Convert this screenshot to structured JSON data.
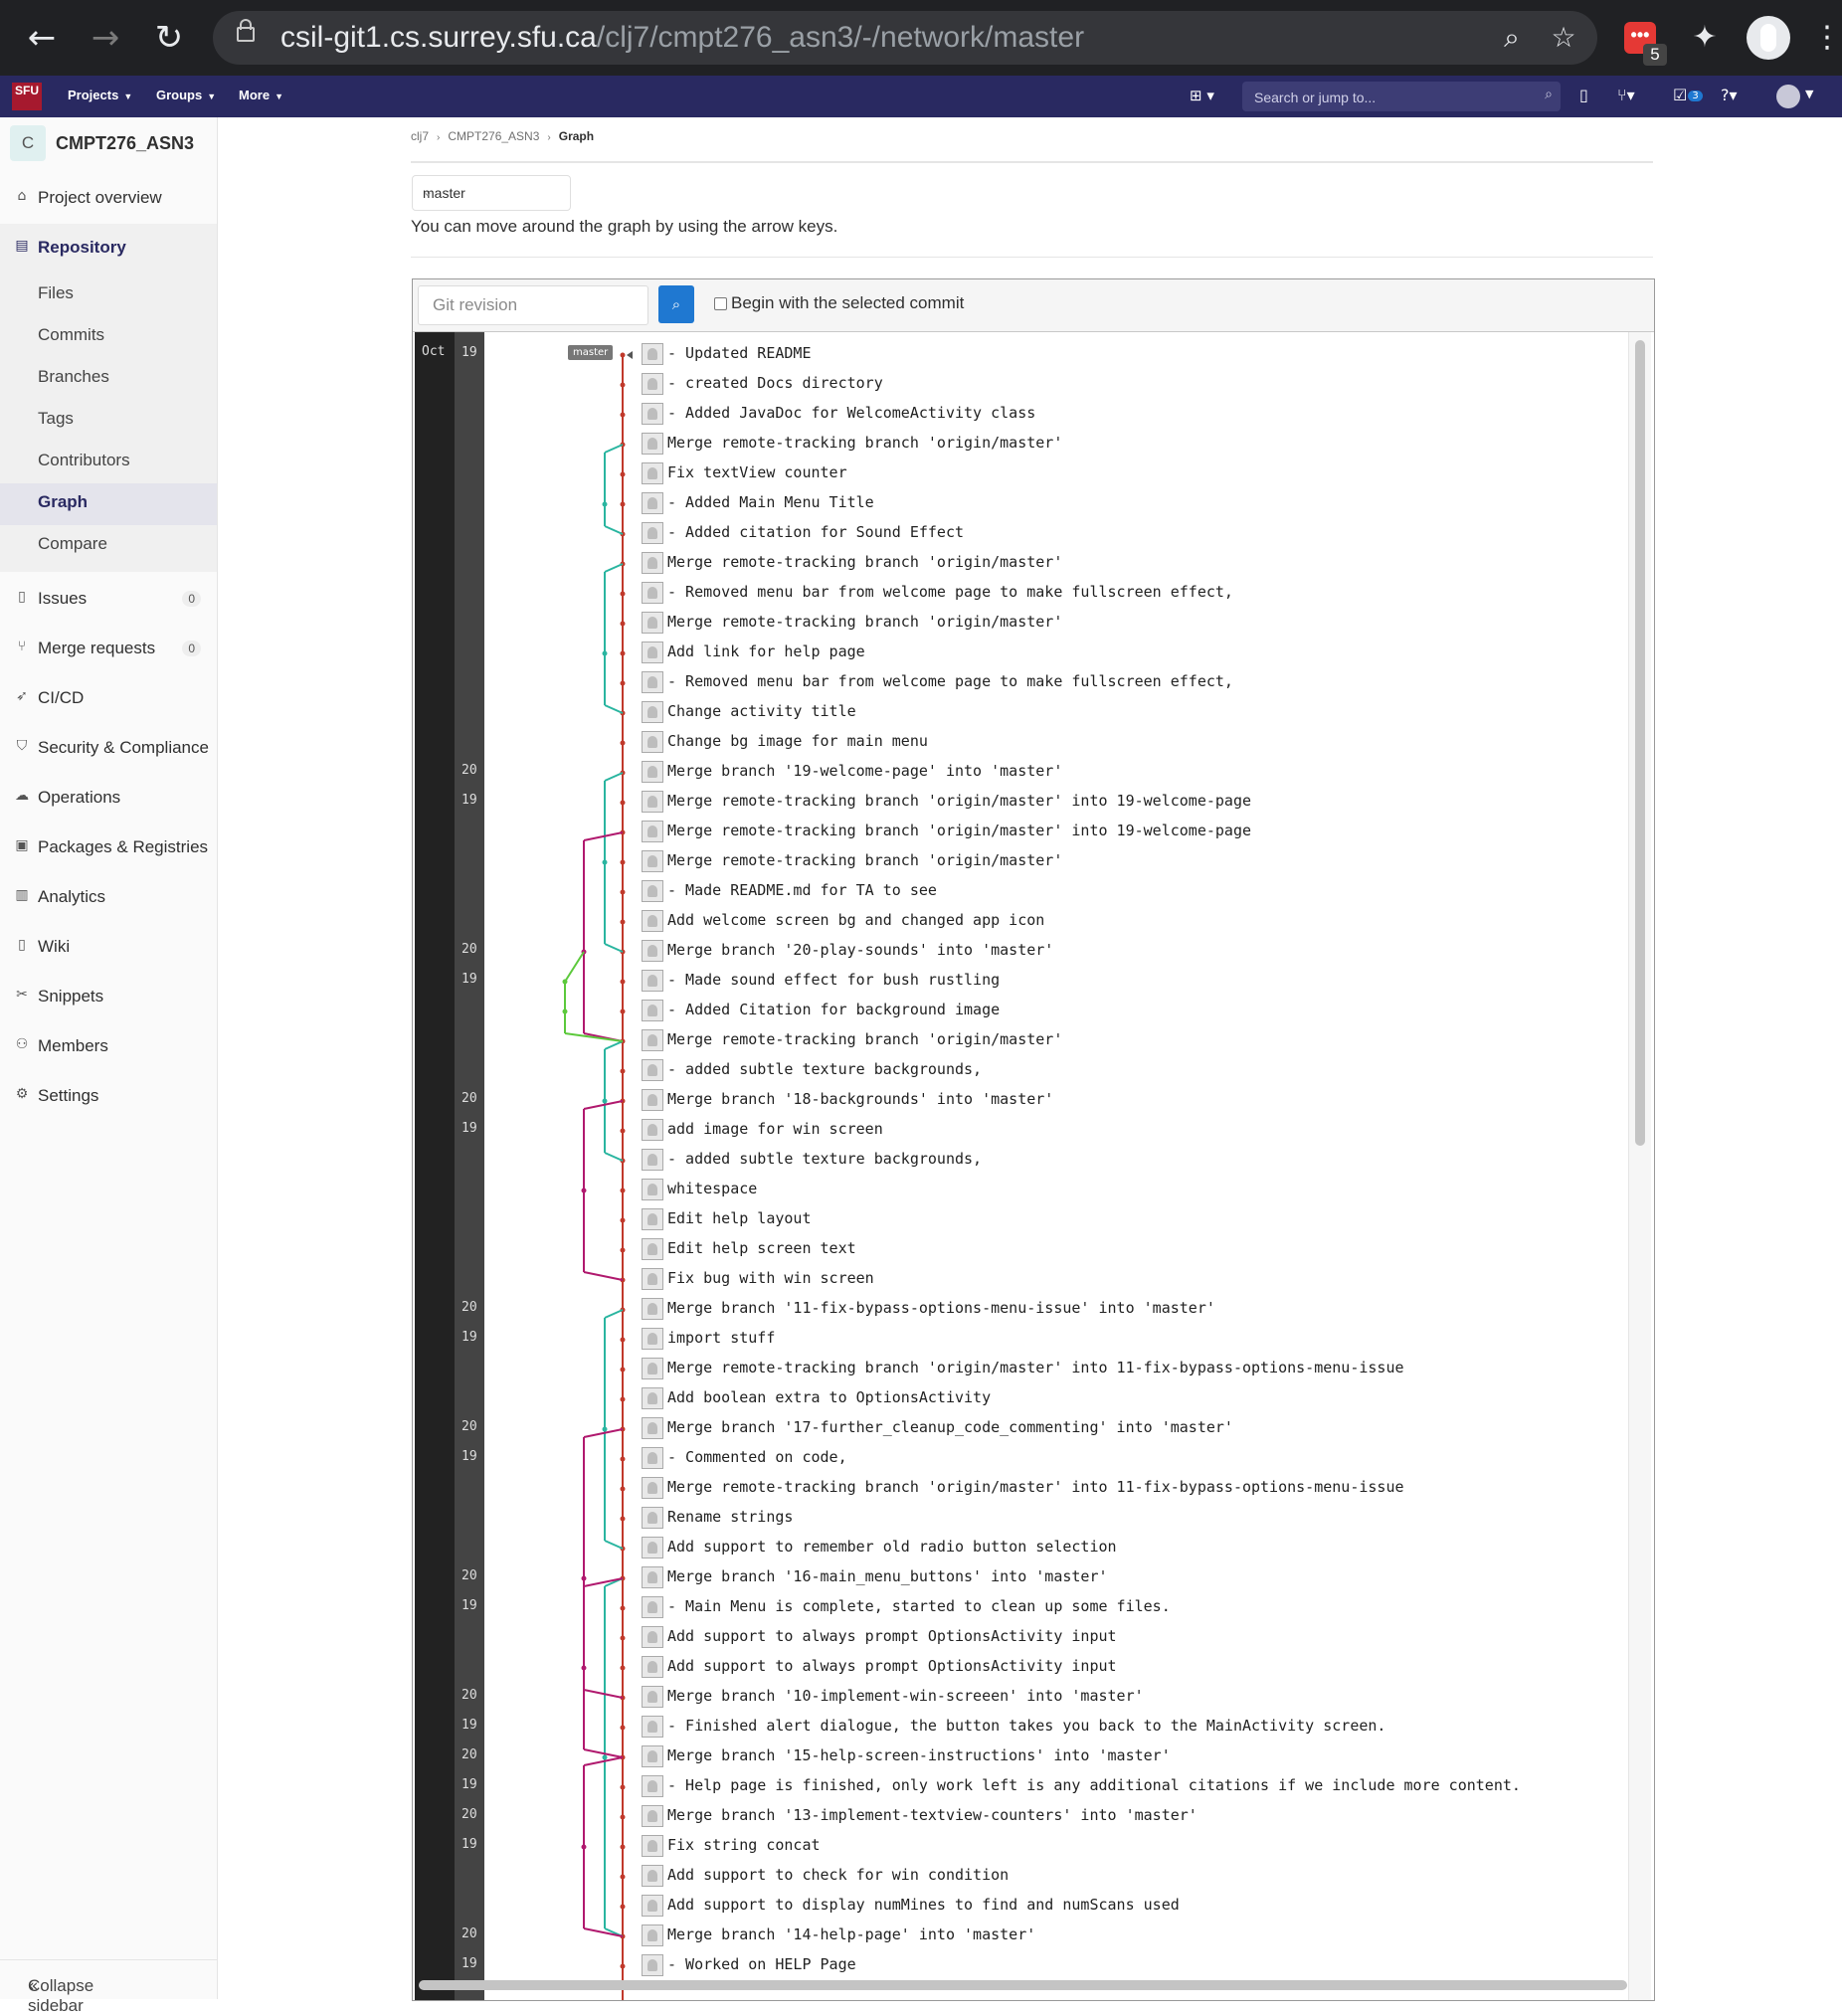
{
  "browser": {
    "url_host": "csil-git1.cs.surrey.sfu.ca",
    "url_path": "/clj7/cmpt276_asn3/-/network/master",
    "extension_badge": "5"
  },
  "topbar": {
    "logo": "SFU",
    "menus": [
      "Projects",
      "Groups",
      "More"
    ],
    "search_placeholder": "Search or jump to...",
    "todo_count": "3"
  },
  "sidebar": {
    "project_initial": "C",
    "project_name": "CMPT276_ASN3",
    "project_overview": "Project overview",
    "repository": "Repository",
    "repo_items": [
      "Files",
      "Commits",
      "Branches",
      "Tags",
      "Contributors",
      "Graph",
      "Compare"
    ],
    "items": [
      {
        "label": "Issues",
        "icon": "issues-icon",
        "count": "0"
      },
      {
        "label": "Merge requests",
        "icon": "merge-request-icon",
        "count": "0"
      },
      {
        "label": "CI/CD",
        "icon": "rocket-icon"
      },
      {
        "label": "Security & Compliance",
        "icon": "shield-icon"
      },
      {
        "label": "Operations",
        "icon": "cloud-icon"
      },
      {
        "label": "Packages & Registries",
        "icon": "package-icon"
      },
      {
        "label": "Analytics",
        "icon": "chart-icon"
      },
      {
        "label": "Wiki",
        "icon": "book-icon"
      },
      {
        "label": "Snippets",
        "icon": "scissors-icon"
      },
      {
        "label": "Members",
        "icon": "users-icon"
      },
      {
        "label": "Settings",
        "icon": "gear-icon"
      }
    ],
    "collapse": "Collapse sidebar"
  },
  "breadcrumb": [
    "clj7",
    "CMPT276_ASN3",
    "Graph"
  ],
  "branch_select": "master",
  "hint": "You can move around the graph by using the arrow keys.",
  "filter": {
    "placeholder": "Git revision",
    "checkbox_label": "Begin with the selected commit"
  },
  "graph": {
    "month": "Oct",
    "branch_label": "master",
    "commits": [
      {
        "day": "19",
        "msg": "- Updated README"
      },
      {
        "day": "",
        "msg": "- created Docs directory"
      },
      {
        "day": "",
        "msg": "- Added JavaDoc for WelcomeActivity class"
      },
      {
        "day": "",
        "msg": "Merge remote-tracking branch 'origin/master'"
      },
      {
        "day": "",
        "msg": "Fix textView counter"
      },
      {
        "day": "",
        "msg": "- Added Main Menu Title"
      },
      {
        "day": "",
        "msg": "- Added citation for Sound Effect"
      },
      {
        "day": "",
        "msg": "Merge remote-tracking branch 'origin/master'"
      },
      {
        "day": "",
        "msg": "- Removed menu bar from welcome page to make fullscreen effect,"
      },
      {
        "day": "",
        "msg": "Merge remote-tracking branch 'origin/master'"
      },
      {
        "day": "",
        "msg": "Add link for help page"
      },
      {
        "day": "",
        "msg": "- Removed menu bar from welcome page to make fullscreen effect,"
      },
      {
        "day": "",
        "msg": "Change activity title"
      },
      {
        "day": "",
        "msg": "Change bg image for main menu"
      },
      {
        "day": "20",
        "msg": "Merge branch '19-welcome-page' into 'master'"
      },
      {
        "day": "19",
        "msg": "Merge remote-tracking branch 'origin/master' into 19-welcome-page"
      },
      {
        "day": "",
        "msg": "Merge remote-tracking branch 'origin/master' into 19-welcome-page"
      },
      {
        "day": "",
        "msg": "Merge remote-tracking branch 'origin/master'"
      },
      {
        "day": "",
        "msg": "- Made README.md for TA to see"
      },
      {
        "day": "",
        "msg": "Add welcome screen bg and changed app icon"
      },
      {
        "day": "20",
        "msg": "Merge branch '20-play-sounds' into 'master'"
      },
      {
        "day": "19",
        "msg": "- Made sound effect for bush rustling"
      },
      {
        "day": "",
        "msg": "- Added Citation for background image"
      },
      {
        "day": "",
        "msg": "Merge remote-tracking branch 'origin/master'"
      },
      {
        "day": "",
        "msg": "- added subtle texture backgrounds,"
      },
      {
        "day": "20",
        "msg": "Merge branch '18-backgrounds' into 'master'"
      },
      {
        "day": "19",
        "msg": "add image for win screen"
      },
      {
        "day": "",
        "msg": "- added subtle texture backgrounds,"
      },
      {
        "day": "",
        "msg": "whitespace"
      },
      {
        "day": "",
        "msg": "Edit help layout"
      },
      {
        "day": "",
        "msg": "Edit help screen text"
      },
      {
        "day": "",
        "msg": "Fix bug with win screen"
      },
      {
        "day": "20",
        "msg": "Merge branch '11-fix-bypass-options-menu-issue' into 'master'"
      },
      {
        "day": "19",
        "msg": "import stuff"
      },
      {
        "day": "",
        "msg": "Merge remote-tracking branch 'origin/master' into 11-fix-bypass-options-menu-issue"
      },
      {
        "day": "",
        "msg": "Add boolean extra to OptionsActivity"
      },
      {
        "day": "20",
        "msg": "Merge branch '17-further_cleanup_code_commenting' into 'master'"
      },
      {
        "day": "19",
        "msg": "- Commented on code,"
      },
      {
        "day": "",
        "msg": "Merge remote-tracking branch 'origin/master' into 11-fix-bypass-options-menu-issue"
      },
      {
        "day": "",
        "msg": "Rename strings"
      },
      {
        "day": "",
        "msg": "Add support to remember old radio button selection"
      },
      {
        "day": "20",
        "msg": "Merge branch '16-main_menu_buttons' into 'master'"
      },
      {
        "day": "19",
        "msg": "- Main Menu is complete, started to clean up some files."
      },
      {
        "day": "",
        "msg": "Add support to always prompt OptionsActivity input"
      },
      {
        "day": "",
        "msg": "Add support to always prompt OptionsActivity input"
      },
      {
        "day": "20",
        "msg": "Merge branch '10-implement-win-screeen' into 'master'"
      },
      {
        "day": "19",
        "msg": "- Finished alert dialogue, the button takes you back to the MainActivity screen."
      },
      {
        "day": "20",
        "msg": "Merge branch '15-help-screen-instructions' into 'master'"
      },
      {
        "day": "19",
        "msg": "- Help page is finished, only work left is any additional citations if we include more content."
      },
      {
        "day": "20",
        "msg": "Merge branch '13-implement-textview-counters' into 'master'"
      },
      {
        "day": "19",
        "msg": "Fix string concat"
      },
      {
        "day": "",
        "msg": "Add support to check for win condition"
      },
      {
        "day": "",
        "msg": "Add support to display numMines to find and numScans used"
      },
      {
        "day": "20",
        "msg": "Merge branch '14-help-page' into 'master'"
      },
      {
        "day": "19",
        "msg": "- Worked on HELP Page"
      }
    ],
    "colors": {
      "master": "#c0392b",
      "teal": "#2ab5a0",
      "magenta": "#b0196e",
      "green": "#5cc93c"
    }
  }
}
